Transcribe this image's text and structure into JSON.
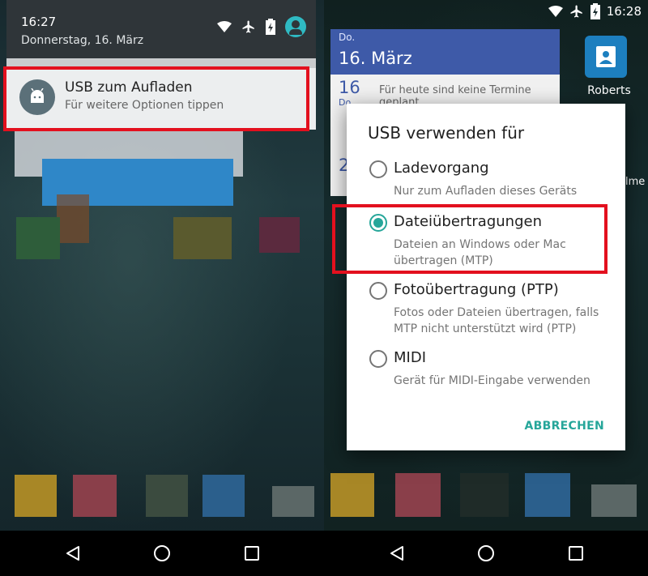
{
  "left": {
    "status": {
      "time": "16:27",
      "date": "Donnerstag, 16. März"
    },
    "notification": {
      "title": "USB zum Aufladen",
      "subtitle": "Für weitere Optionen tippen"
    }
  },
  "right": {
    "status": {
      "time": "16:28"
    },
    "calendar": {
      "weekday": "Do.",
      "date": "16. März",
      "day_num": "16",
      "day_abbr": "Do",
      "message": "Für heute sind keine Termine geplant",
      "next_num": "2"
    },
    "contact": {
      "label": "Roberts"
    },
    "edge_text": "lme",
    "dialog": {
      "title": "USB verwenden für",
      "options": [
        {
          "label": "Ladevorgang",
          "desc": "Nur zum Aufladen dieses Geräts",
          "selected": false
        },
        {
          "label": "Dateiübertragungen",
          "desc": "Dateien an Windows oder Mac übertragen (MTP)",
          "selected": true
        },
        {
          "label": "Fotoübertragung (PTP)",
          "desc": "Fotos oder Dateien übertragen, falls MTP nicht unterstützt wird (PTP)",
          "selected": false
        },
        {
          "label": "MIDI",
          "desc": "Gerät für MIDI-Eingabe verwenden",
          "selected": false
        }
      ],
      "cancel": "ABBRECHEN"
    }
  },
  "colors": {
    "accent": "#26a69a",
    "highlight": "#e3101e",
    "calendar": "#3e5aa8"
  },
  "icons": [
    "wifi-icon",
    "airplane-icon",
    "battery-charging-icon",
    "user-icon",
    "android-icon",
    "back-icon",
    "home-icon",
    "recents-icon",
    "contacts-icon"
  ]
}
